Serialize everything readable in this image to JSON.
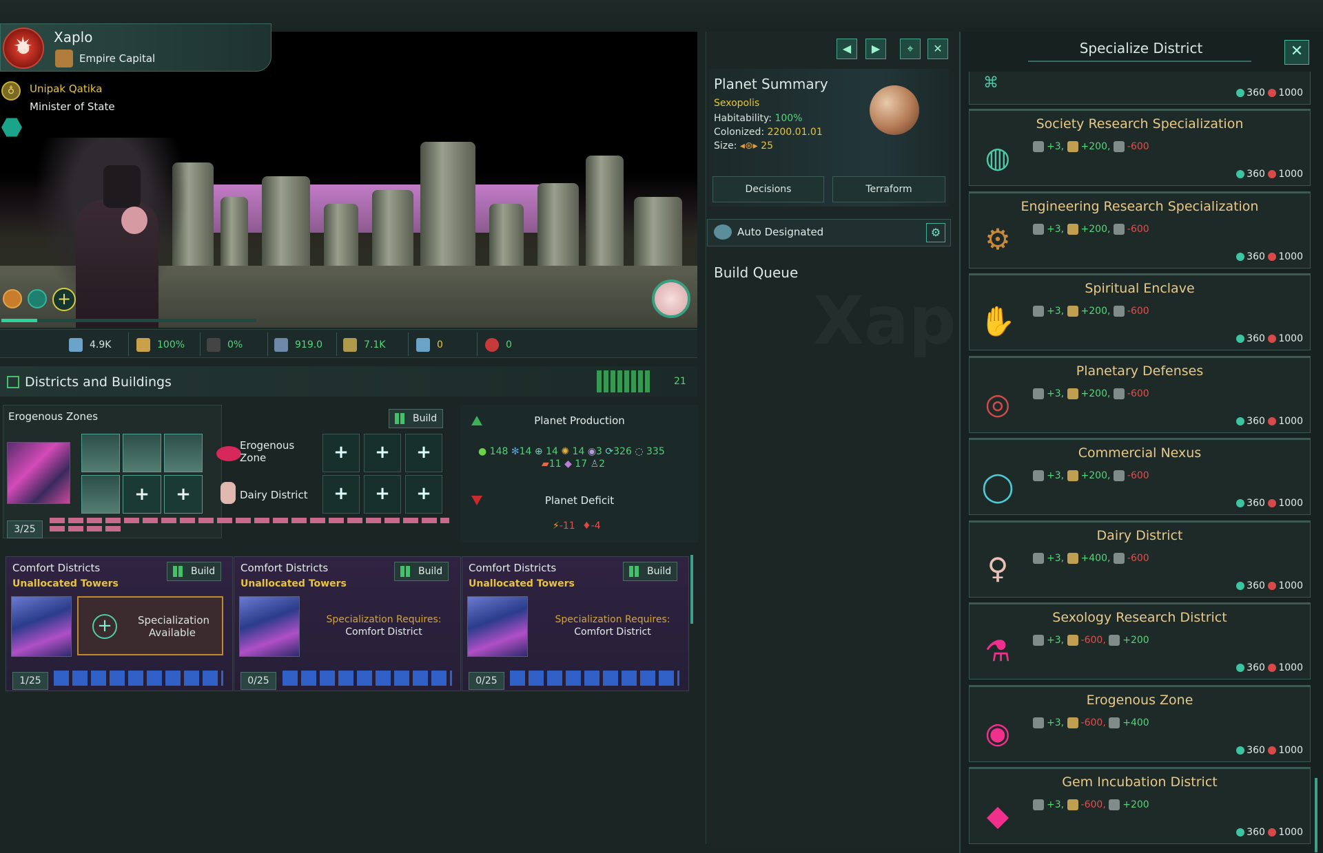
{
  "header": {
    "planet_name": "Xaplo",
    "planet_type": "Empire Capital",
    "leader_name": "Unipak Qatika",
    "leader_role": "Minister of State"
  },
  "stats": [
    {
      "icon": "pops-icon",
      "value": "4.9K"
    },
    {
      "icon": "stability-icon",
      "value": "100%",
      "color": "#56d47a"
    },
    {
      "icon": "crime-icon",
      "value": "0%",
      "color": "#56d47a"
    },
    {
      "icon": "amenities-icon",
      "value": "919.0",
      "color": "#56d47a"
    },
    {
      "icon": "housing-icon",
      "value": "7.1K",
      "color": "#56d47a"
    },
    {
      "icon": "free-jobs-icon",
      "value": "0",
      "color": "#e7c536"
    },
    {
      "icon": "devastation-icon",
      "value": "0",
      "color": "#56d47a"
    }
  ],
  "districts": {
    "title": "Districts and Buildings",
    "count": "21",
    "erogenous": {
      "title": "Erogenous Zones",
      "build_label": "Build",
      "row1_label": "Erogenous Zone",
      "row2_label": "Dairy District",
      "count": "3/25"
    },
    "production": {
      "title": "Planet Production",
      "row1": [
        "148",
        "14",
        "14",
        "14",
        "3",
        "326",
        "335"
      ],
      "row2": [
        "11",
        "17",
        "2"
      ],
      "deficit_title": "Planet Deficit",
      "deficit": [
        "-11",
        "-4"
      ]
    },
    "comfort": [
      {
        "title": "Comfort Districts",
        "sub": "Unallocated Towers",
        "build": "Build",
        "spec_line1": "Specialization",
        "spec_line2": "Available",
        "count": "1/25"
      },
      {
        "title": "Comfort Districts",
        "sub": "Unallocated Towers",
        "build": "Build",
        "req_line1": "Specialization Requires:",
        "req_line2": "Comfort District",
        "count": "0/25"
      },
      {
        "title": "Comfort Districts",
        "sub": "Unallocated Towers",
        "build": "Build",
        "req_line1": "Specialization Requires:",
        "req_line2": "Comfort District",
        "count": "0/25"
      }
    ]
  },
  "summary": {
    "title": "Planet Summary",
    "name": "Sexopolis",
    "habitability_label": "Habitability:",
    "habitability": "100%",
    "colonized_label": "Colonized:",
    "colonized": "2200.01.01",
    "size_label": "Size:",
    "size": "25",
    "decisions": "Decisions",
    "terraform": "Terraform",
    "auto": "Auto Designated",
    "build_queue": "Build Queue"
  },
  "spec": {
    "title": "Specialize District",
    "top_cost_a": "360",
    "top_cost_b": "1000",
    "cards": [
      {
        "title": "Society Research Specialization",
        "e1": "+3,",
        "e2": "+200,",
        "e3": "-600",
        "cost_a": "360",
        "cost_b": "1000",
        "icon": "globe-icon"
      },
      {
        "title": "Engineering Research Specialization",
        "e1": "+3,",
        "e2": "+200,",
        "e3": "-600",
        "cost_a": "360",
        "cost_b": "1000",
        "icon": "gear-icon"
      },
      {
        "title": "Spiritual Enclave",
        "e1": "+3,",
        "e2": "+200,",
        "e3": "-600",
        "cost_a": "360",
        "cost_b": "1000",
        "icon": "hands-icon"
      },
      {
        "title": "Planetary Defenses",
        "e1": "+3,",
        "e2": "+200,",
        "e3": "-600",
        "cost_a": "360",
        "cost_b": "1000",
        "icon": "target-icon"
      },
      {
        "title": "Commercial Nexus",
        "e1": "+3,",
        "e2": "+200,",
        "e3": "-600",
        "cost_a": "360",
        "cost_b": "1000",
        "icon": "ring-icon"
      },
      {
        "title": "Dairy District",
        "e1": "+3,",
        "e2": "+400,",
        "e3": "-600",
        "cost_a": "360",
        "cost_b": "1000",
        "icon": "dairy-icon"
      },
      {
        "title": "Sexology Research District",
        "e1": "+3,",
        "e2": "-600,",
        "e3": "+200",
        "cost_a": "360",
        "cost_b": "1000",
        "icon": "flask-icon"
      },
      {
        "title": "Erogenous Zone",
        "e1": "+3,",
        "e2": "-600,",
        "e3": "+400",
        "cost_a": "360",
        "cost_b": "1000",
        "icon": "lips-icon"
      },
      {
        "title": "Gem Incubation District",
        "e1": "+3,",
        "e2": "-600,",
        "e3": "+200",
        "cost_a": "360",
        "cost_b": "1000",
        "icon": "gem-icon"
      }
    ]
  }
}
